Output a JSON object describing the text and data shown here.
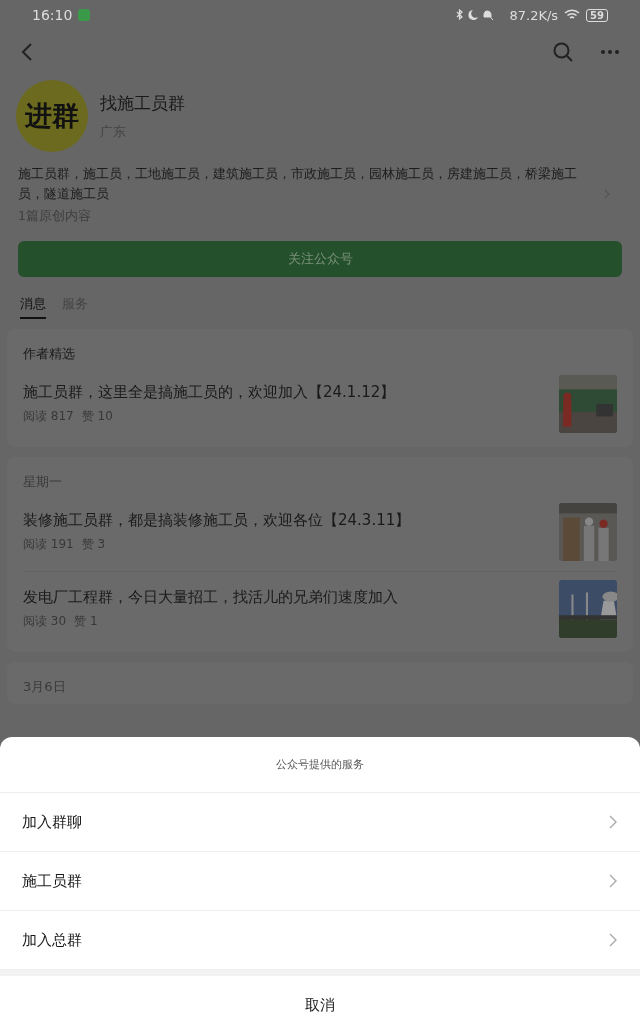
{
  "status_bar": {
    "time": "16:10",
    "speed": "87.2K/s",
    "battery": "59"
  },
  "account": {
    "avatar_text": "进群",
    "name": "找施工员群",
    "region": "广东",
    "tags": "施工员群，施工员，工地施工员，建筑施工员，市政施工员，园林施工员，房建施工员，桥梁施工员，隧道施工员",
    "original_count": "1篇原创内容",
    "follow_button": "关注公众号"
  },
  "tabs": [
    {
      "label": "消息",
      "selected": true
    },
    {
      "label": "服务",
      "selected": false
    }
  ],
  "sections": [
    {
      "title": "作者精选",
      "kind": "featured",
      "articles": [
        {
          "title": "施工员群，这里全是搞施工员的，欢迎加入【24.1.12】",
          "reads": "阅读 817",
          "likes": "赞 10",
          "kind": "picture"
        }
      ]
    },
    {
      "title": "星期一",
      "kind": "date",
      "articles": [
        {
          "title": "装修施工员群，都是搞装修施工员，欢迎各位【24.3.11】",
          "reads": "阅读 191",
          "likes": "赞 3",
          "kind": "picture"
        },
        {
          "title": "发电厂工程群，今日大量招工，找活儿的兄弟们速度加入",
          "reads": "阅读 30",
          "likes": "赞 1",
          "kind": "picture"
        }
      ]
    },
    {
      "title": "3月6日",
      "kind": "date"
    }
  ],
  "sheet": {
    "title": "公众号提供的服务",
    "items": [
      "加入群聊",
      "施工员群",
      "加入总群"
    ],
    "cancel": "取消"
  }
}
